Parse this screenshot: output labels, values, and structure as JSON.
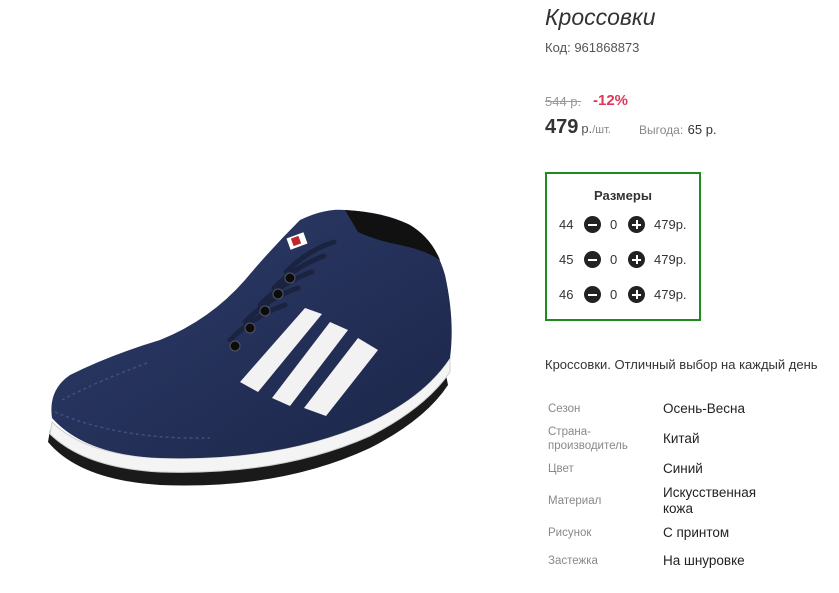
{
  "product": {
    "title": "Кроссовки",
    "code": "Код: 961868873",
    "old_price": "544 р.",
    "discount": "-12%",
    "price": "479",
    "price_unit": "р.",
    "price_per": "/шт.",
    "savings_label": "Выгода:",
    "savings_value": "65 р."
  },
  "sizes": {
    "title": "Размеры",
    "rows": [
      {
        "size": "44",
        "qty": "0",
        "price": "479р."
      },
      {
        "size": "45",
        "qty": "0",
        "price": "479р."
      },
      {
        "size": "46",
        "qty": "0",
        "price": "479р."
      }
    ]
  },
  "description": "Кроссовки. Отличный выбор на каждый день",
  "properties": [
    {
      "label": "Сезон",
      "value": "Осень-Весна"
    },
    {
      "label": "Страна-производитель",
      "value": "Китай"
    },
    {
      "label": "Цвет",
      "value": "Синий"
    },
    {
      "label": "Материал",
      "value": "Искусственная кожа"
    },
    {
      "label": "Рисунок",
      "value": "С принтом"
    },
    {
      "label": "Застежка",
      "value": "На шнуровке"
    }
  ],
  "colors": {
    "accent_border": "#1f8a1f",
    "discount": "#e0365a",
    "shoe_body": "#22305a"
  }
}
